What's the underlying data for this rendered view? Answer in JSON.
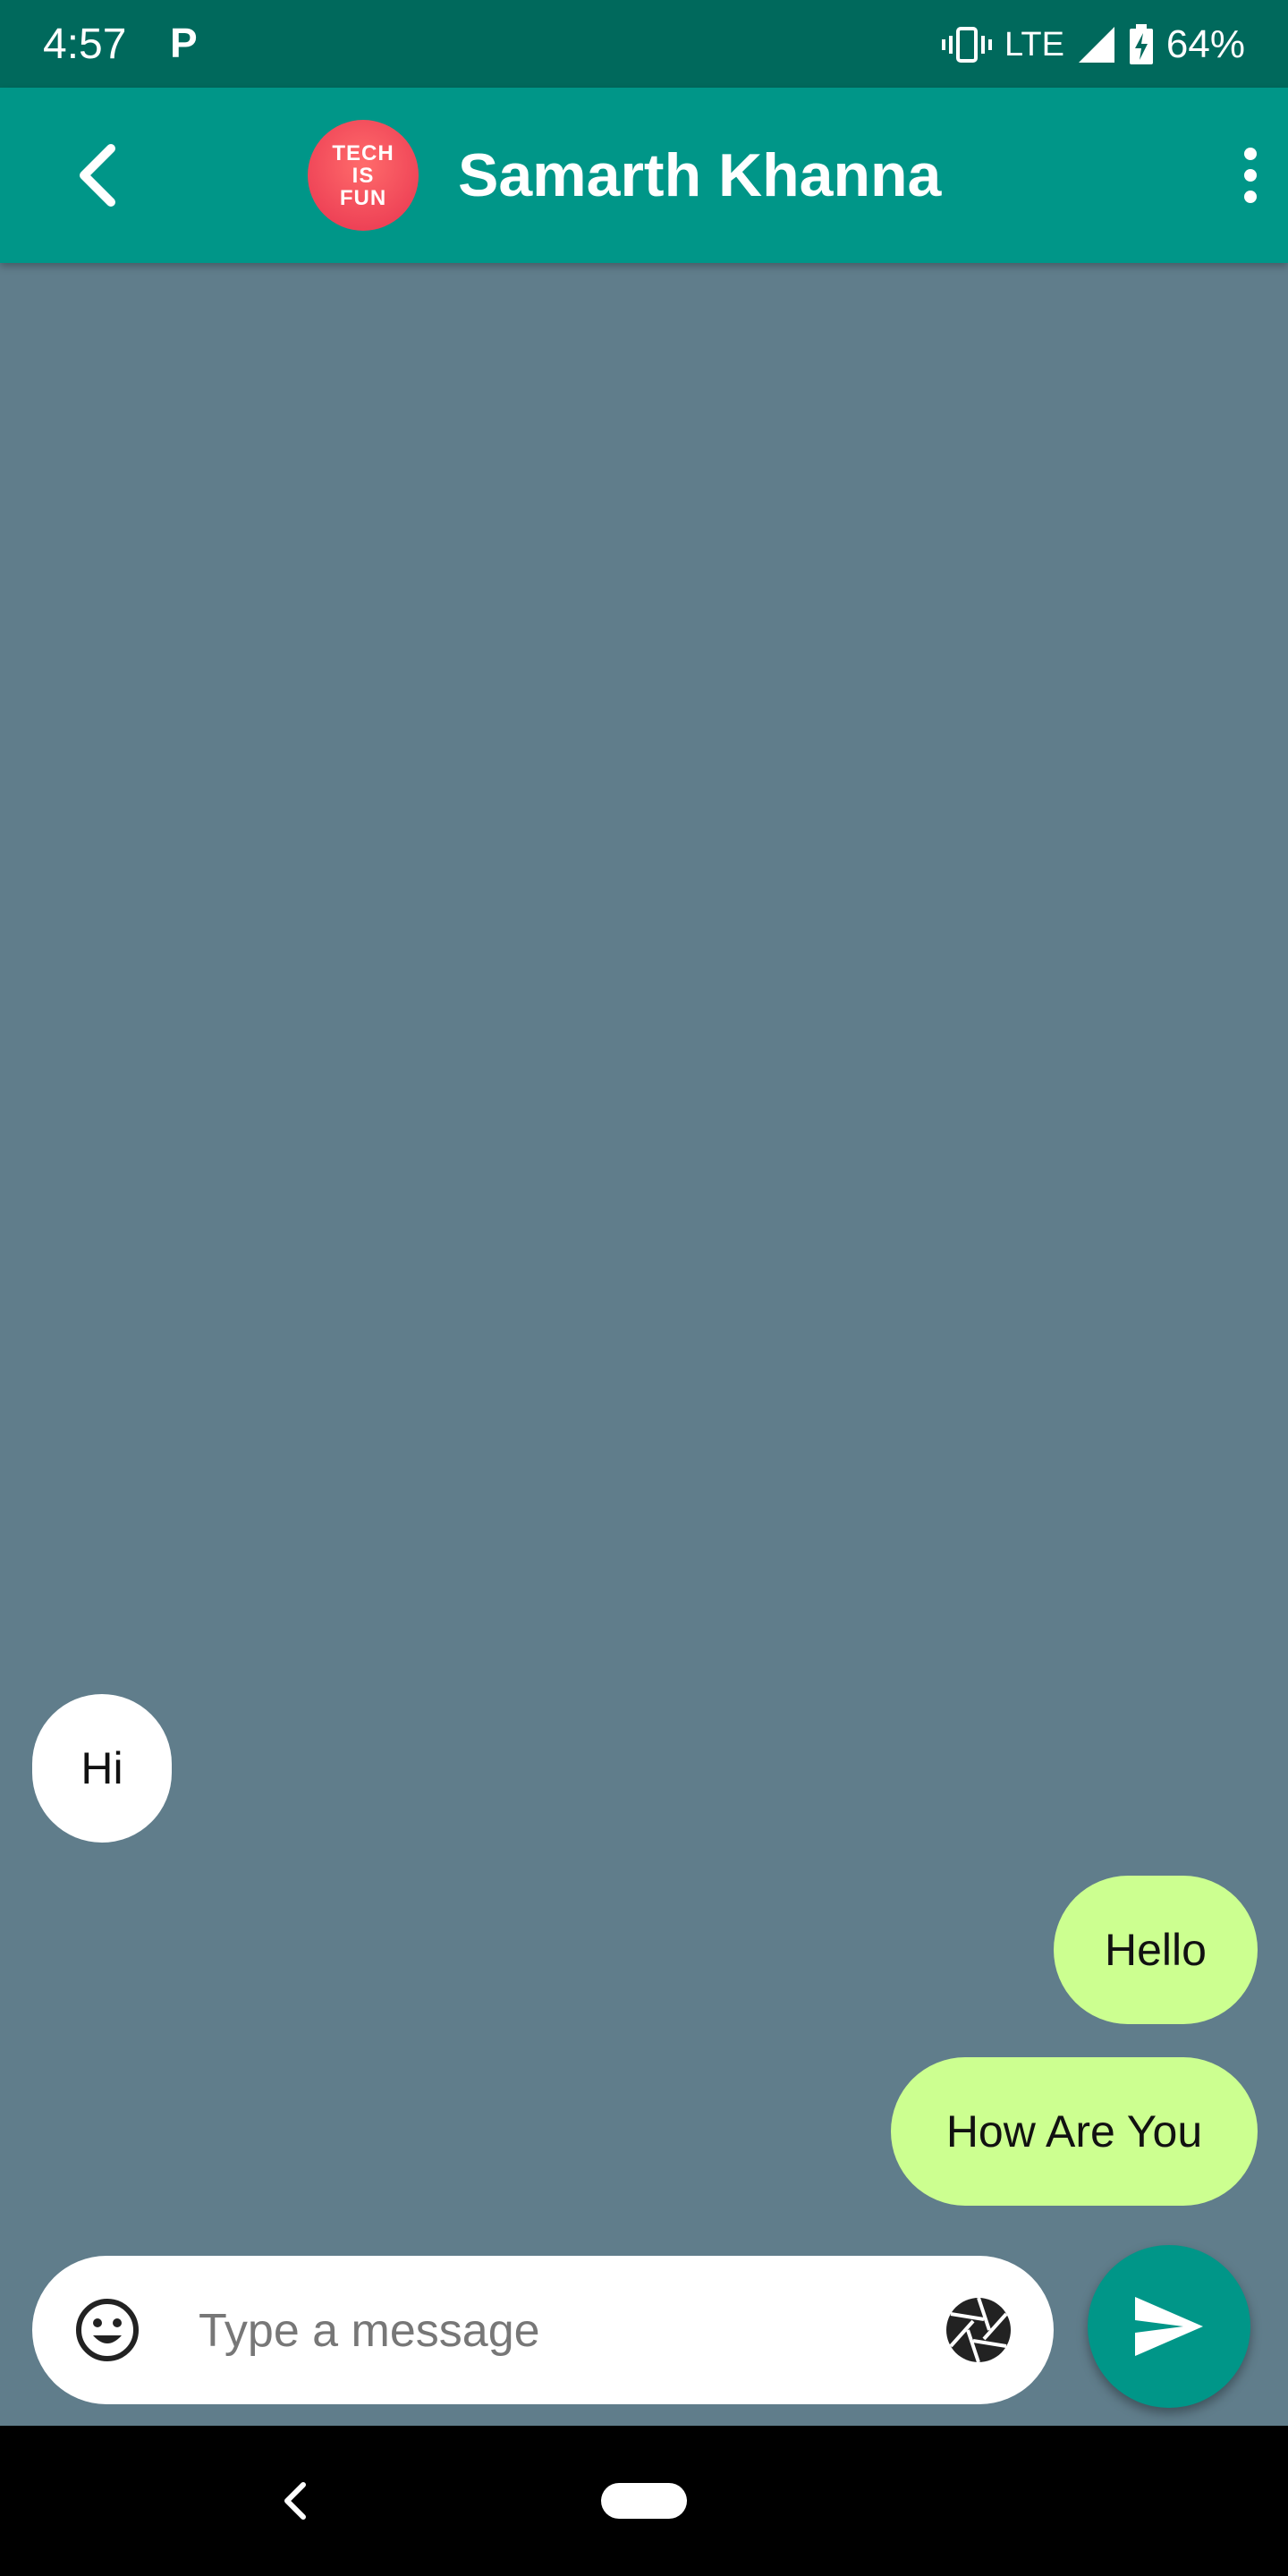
{
  "status_bar": {
    "time": "4:57",
    "app_indicator": "P",
    "network": "LTE",
    "battery": "64%"
  },
  "header": {
    "avatar_text": [
      "TECH",
      "IS",
      "FUN"
    ],
    "contact_name": "Samarth Khanna"
  },
  "messages": [
    {
      "direction": "incoming",
      "text": "Hi"
    },
    {
      "direction": "outgoing",
      "text": "Hello"
    },
    {
      "direction": "outgoing",
      "text": "How Are You"
    }
  ],
  "composer": {
    "placeholder": "Type a message",
    "value": ""
  },
  "icons": {
    "back": "arrow-back-icon",
    "more": "more-vert-icon",
    "emoji": "emoji-icon",
    "camera": "camera-icon",
    "send": "send-icon",
    "nav_back": "nav-back-icon",
    "nav_home": "nav-home-pill"
  },
  "colors": {
    "status_bar": "#00695c",
    "app_bar": "#009688",
    "chat_background": "#607d8b",
    "incoming_bubble": "#ffffff",
    "outgoing_bubble": "#ccff90",
    "send_button": "#009688"
  }
}
